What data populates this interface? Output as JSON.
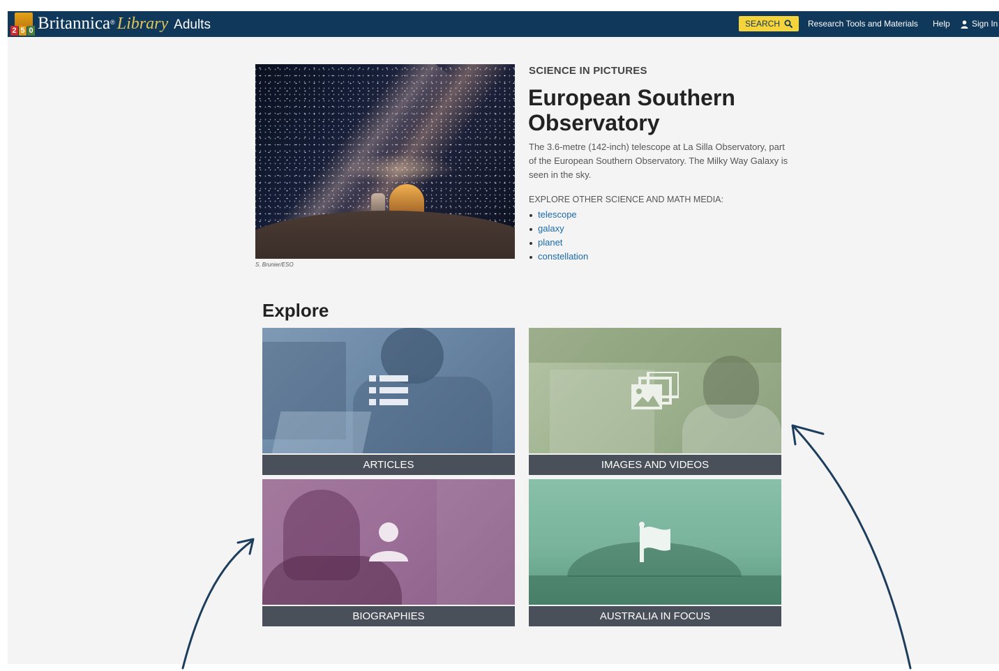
{
  "header": {
    "logo_number": "250",
    "brand_main": "Britannica",
    "brand_reg": "®",
    "brand_library": "Library",
    "brand_audience": "Adults",
    "search_label": "SEARCH",
    "nav": {
      "research": "Research Tools and Materials",
      "help": "Help",
      "sign_in": "Sign In"
    }
  },
  "media": {
    "eyebrow": "SCIENCE IN PICTURES",
    "title": "European Southern Observatory",
    "caption": "The 3.6-metre (142-inch) telescope at La Silla Observatory, part of the European Southern Observatory. The Milky Way Galaxy is seen in the sky.",
    "credit": "S. Brunier/ESO",
    "explore_label": "EXPLORE OTHER SCIENCE AND MATH MEDIA:",
    "links": [
      "telescope",
      "galaxy",
      "planet",
      "constellation"
    ]
  },
  "explore": {
    "heading": "Explore",
    "tiles": [
      {
        "label": "ARTICLES",
        "icon": "list-icon",
        "color": "#6b88a6"
      },
      {
        "label": "IMAGES AND VIDEOS",
        "icon": "gallery-icon",
        "color": "#9eb28f"
      },
      {
        "label": "BIOGRAPHIES",
        "icon": "person-icon",
        "color": "#9a6e96"
      },
      {
        "label": "AUSTRALIA IN FOCUS",
        "icon": "flag-icon",
        "color": "#79b39c"
      }
    ]
  },
  "colors": {
    "header_bg": "#10385a",
    "search_button": "#f5d33a",
    "link": "#1a6aae",
    "tile_bar": "#4a5059",
    "annotation_arrow": "#1d3d5c"
  }
}
